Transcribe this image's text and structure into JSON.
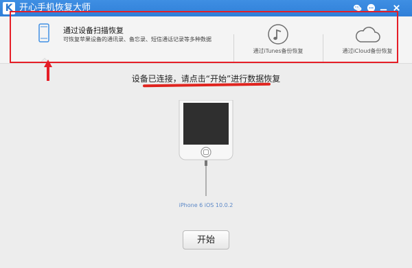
{
  "window": {
    "title": "开心手机恢复大师",
    "logo_letter": "K"
  },
  "modes": [
    {
      "title": "通过设备扫描恢复",
      "description": "可恢复苹果设备的通讯录、备忘录、短信通话记录等多种数据",
      "icon": "iphone-icon",
      "selected": true
    },
    {
      "label": "通过iTunes备份恢复",
      "icon": "itunes-music-icon"
    },
    {
      "label": "通过iCloud备份恢复",
      "icon": "icloud-icon"
    }
  ],
  "status": {
    "message": "设备已连接，请点击“开始”进行数据恢复"
  },
  "device": {
    "label": "iPhone 6 iOS 10.0.2"
  },
  "actions": {
    "start_label": "开始"
  },
  "colors": {
    "titlebar": "#2f7fd8",
    "annotation_red": "#e51d26",
    "device_label_blue": "#5a87c7"
  }
}
